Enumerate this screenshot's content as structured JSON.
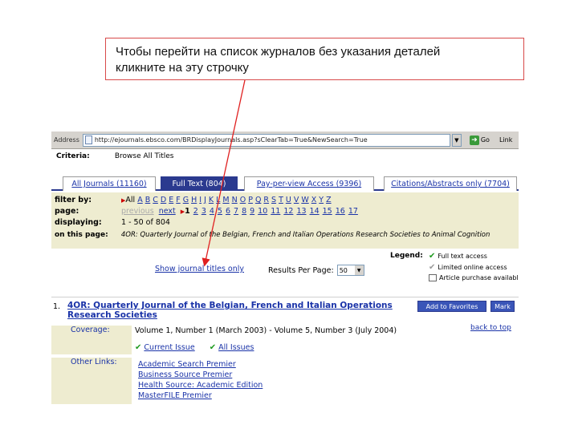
{
  "callout": {
    "line1": "Чтобы перейти на список журналов без указания деталей",
    "line2": "кликните на эту строчку"
  },
  "address_bar": {
    "label": "Address",
    "url": "http://ejournals.ebsco.com/BRDisplayJournals.asp?sClearTab=True&NewSearch=True",
    "go": "Go",
    "links": "Link"
  },
  "criteria": {
    "label": "Criteria:",
    "value": "Browse All Titles"
  },
  "tabs": [
    {
      "label": "All Journals (11160)"
    },
    {
      "label": "Full Text (804)"
    },
    {
      "label": "Pay-per-view Access (9396)"
    },
    {
      "label": "Citations/Abstracts only (7704)"
    }
  ],
  "filter": {
    "filter_by_label": "filter by:",
    "all": "All",
    "letters": [
      "A",
      "B",
      "C",
      "D",
      "E",
      "F",
      "G",
      "H",
      "I",
      "J",
      "K",
      "L",
      "M",
      "N",
      "O",
      "P",
      "Q",
      "R",
      "S",
      "T",
      "U",
      "V",
      "W",
      "X",
      "Y",
      "Z"
    ],
    "page_label": "page:",
    "previous": "previous",
    "next": "next",
    "pages": [
      "1",
      "2",
      "3",
      "4",
      "5",
      "6",
      "7",
      "8",
      "9",
      "10",
      "11",
      "12",
      "13",
      "14",
      "15",
      "16",
      "17"
    ],
    "displaying_label": "displaying:",
    "displaying_value": "1 - 50 of 804",
    "on_this_page_label": "on this page:",
    "on_this_page_value": "4OR: Quarterly Journal of the Belgian, French and Italian Operations Research Societies to Animal Cognition"
  },
  "legend": {
    "title": "Legend:",
    "full_text": "Full text access",
    "limited": "Limited online access",
    "article_purchase": "Article purchase available"
  },
  "show_link": "Show journal titles only",
  "results_per_page": {
    "label": "Results Per Page:",
    "value": "50"
  },
  "result": {
    "number": "1.",
    "title": "4OR: Quarterly Journal of the Belgian, French and Italian Operations Research Societies",
    "add_favorites": "Add to Favorites",
    "mark": "Mark",
    "back_to_top": "back to top",
    "coverage_label": "Coverage:",
    "coverage_value": "Volume 1, Number 1 (March 2003) - Volume 5, Number 3 (July 2004)",
    "current_issue": "Current Issue",
    "all_issues": "All Issues",
    "other_links_label": "Other Links:",
    "other_links": [
      "Academic Search Premier",
      "Business Source Premier",
      "Health Source: Academic Edition",
      "MasterFILE Premier"
    ]
  },
  "colors": {
    "callout_border": "#d84a4a",
    "arrow": "#e02020",
    "tab_active": "#2b3a8f",
    "filter_bg": "#eeecd0",
    "link": "#1a33a8"
  }
}
